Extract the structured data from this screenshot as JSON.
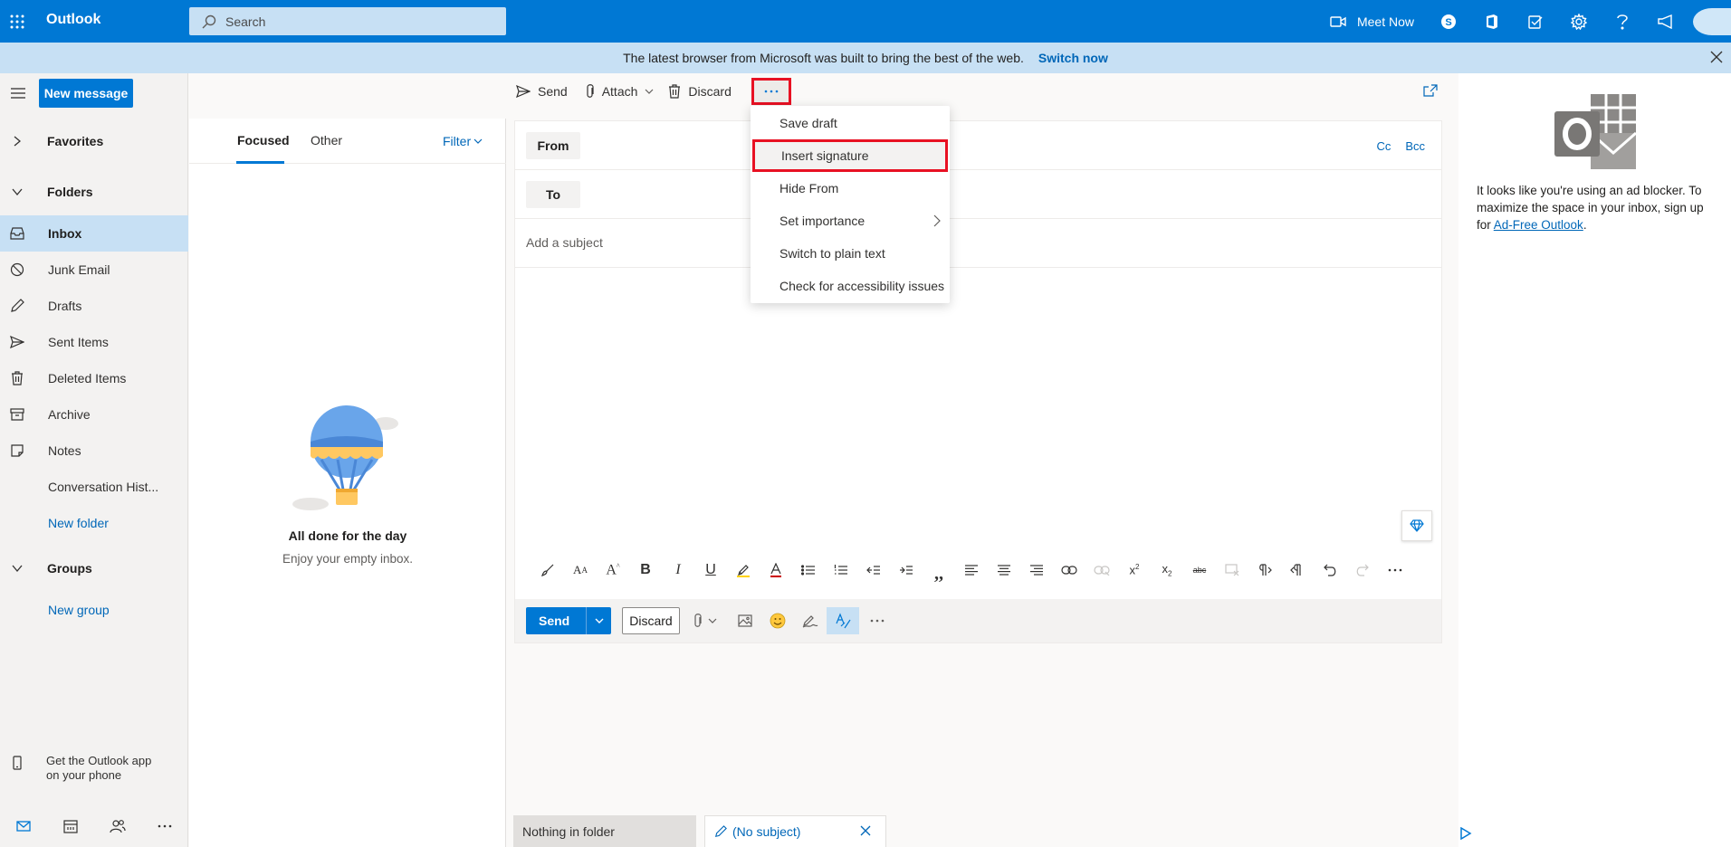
{
  "topbar": {
    "app_name": "Outlook",
    "search_placeholder": "Search",
    "meet_now": "Meet Now"
  },
  "banner": {
    "text": "The latest browser from Microsoft was built to bring the best of the web.",
    "link": "Switch now"
  },
  "leftnav": {
    "new_message": "New message",
    "favorites": "Favorites",
    "folders": "Folders",
    "items": [
      {
        "label": "Inbox",
        "icon": "inbox-icon"
      },
      {
        "label": "Junk Email",
        "icon": "junk-icon"
      },
      {
        "label": "Drafts",
        "icon": "pencil-icon"
      },
      {
        "label": "Sent Items",
        "icon": "send-icon"
      },
      {
        "label": "Deleted Items",
        "icon": "trash-icon"
      },
      {
        "label": "Archive",
        "icon": "archive-icon"
      },
      {
        "label": "Notes",
        "icon": "note-icon"
      },
      {
        "label": "Conversation Hist..."
      },
      {
        "label": "New folder"
      }
    ],
    "groups": "Groups",
    "new_group": "New group",
    "get_app": "Get the Outlook app on your phone"
  },
  "msglist": {
    "tab_focused": "Focused",
    "tab_other": "Other",
    "filter": "Filter",
    "empty_title": "All done for the day",
    "empty_sub": "Enjoy your empty inbox."
  },
  "cmdbar": {
    "send": "Send",
    "attach": "Attach",
    "discard": "Discard",
    "more": "···"
  },
  "compose": {
    "from": "From",
    "to": "To",
    "cc": "Cc",
    "bcc": "Bcc",
    "subject_placeholder": "Add a subject",
    "send": "Send",
    "discard": "Discard"
  },
  "dropdown": {
    "items": [
      "Save draft",
      "Insert signature",
      "Hide From",
      "Set importance",
      "Switch to plain text",
      "Check for accessibility issues"
    ]
  },
  "bottom_tabs": {
    "tab1": "Nothing in folder",
    "tab2": "(No subject)"
  },
  "ad": {
    "text": "It looks like you're using an ad blocker. To maximize the space in your inbox, sign up for ",
    "link": "Ad-Free Outlook",
    "end": "."
  },
  "colors": {
    "brand": "#0078d4",
    "highlight": "#e81123"
  }
}
